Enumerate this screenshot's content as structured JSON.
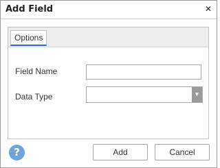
{
  "dialog": {
    "title": "Add Field",
    "close_glyph": "✕"
  },
  "tabs": [
    {
      "label": "Options",
      "active": true
    }
  ],
  "form": {
    "field_name_label": "Field Name",
    "field_name_value": "",
    "data_type_label": "Data Type",
    "data_type_value": ""
  },
  "footer": {
    "help_glyph": "?",
    "add_label": "Add",
    "cancel_label": "Cancel"
  },
  "colors": {
    "tab_accent": "#1e6fc0",
    "help_icon": "#6ea3dc",
    "dropdown_arrow_bg": "#9a9a9a"
  }
}
